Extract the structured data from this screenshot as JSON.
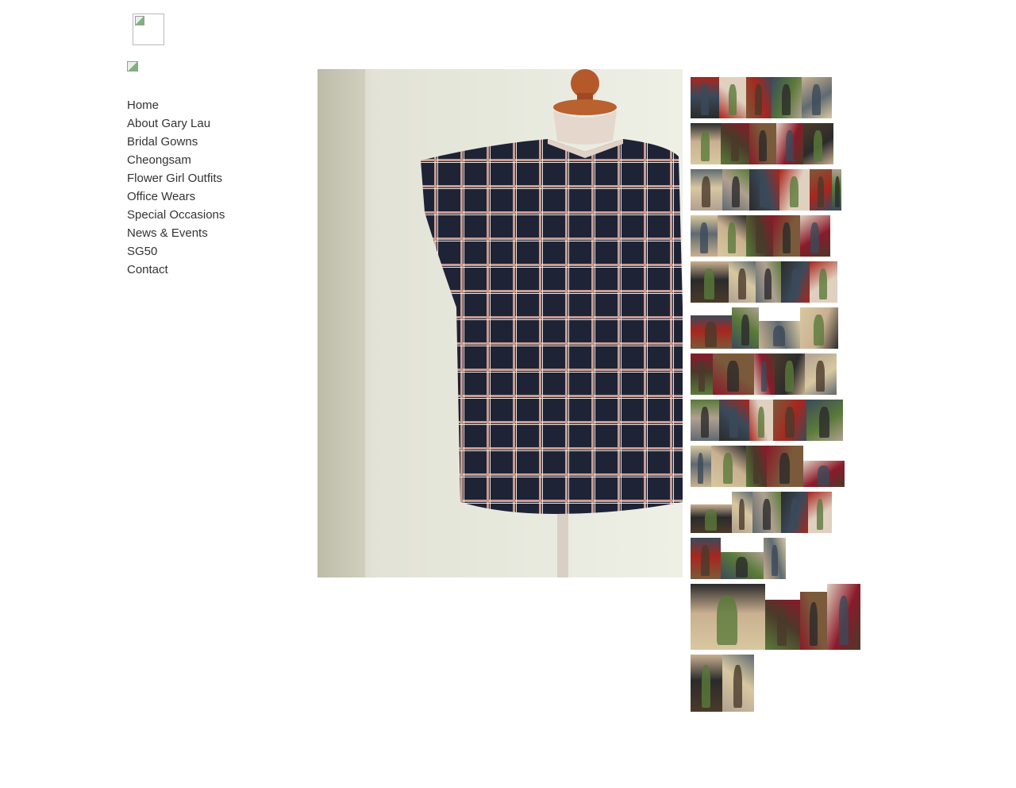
{
  "nav": {
    "items": [
      {
        "label": "Home"
      },
      {
        "label": "About Gary Lau"
      },
      {
        "label": "Bridal Gowns"
      },
      {
        "label": "Cheongsam"
      },
      {
        "label": "Flower Girl Outfits"
      },
      {
        "label": "Office Wears"
      },
      {
        "label": "Special Occasions"
      },
      {
        "label": "News & Events"
      },
      {
        "label": "SG50"
      },
      {
        "label": "Contact"
      }
    ]
  },
  "main_photo": {
    "subject": "plaid sleeveless top on dress form",
    "colors": {
      "fabric": "#1e2236",
      "check": "#c9a29a",
      "stand": "#b45a2a"
    }
  },
  "thumbnail_rows": 13,
  "thumbnail_palette": [
    "#2b2b2b",
    "#a8261e",
    "#7a5a3a",
    "#3b4a5a",
    "#c9b090",
    "#d8c8a0",
    "#5a7a3a",
    "#8a1a2a",
    "#e0d0c0",
    "#4a3a2a",
    "#b0a090",
    "#606a70"
  ]
}
